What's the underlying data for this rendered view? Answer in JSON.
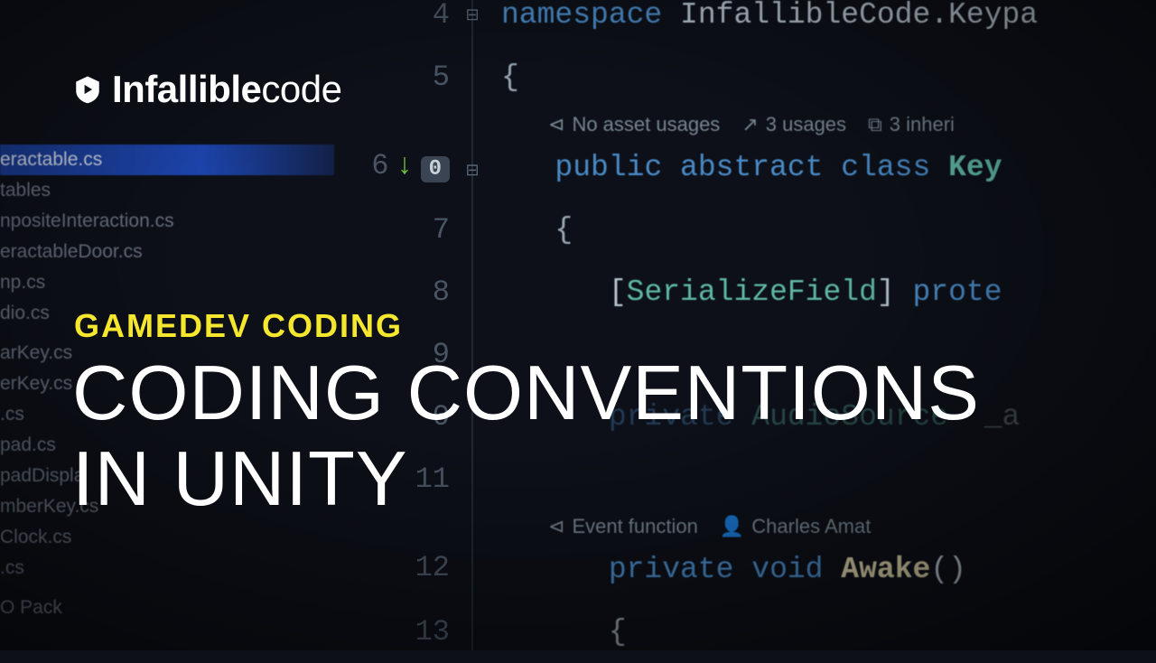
{
  "brand": {
    "bold": "Infallible",
    "thin": "code"
  },
  "overline": "GAMEDEV CODING",
  "title_line1": "CODING CONVENTIONS",
  "title_line2": "IN UNITY",
  "sidebar": {
    "items": [
      {
        "label": "eractable.cs",
        "selected": true
      },
      {
        "label": "tables",
        "selected": false
      },
      {
        "label": "npositeInteraction.cs",
        "selected": false
      },
      {
        "label": "eractableDoor.cs",
        "selected": false
      },
      {
        "label": "np.cs",
        "selected": false
      },
      {
        "label": "dio.cs",
        "selected": false
      },
      {
        "label": "",
        "selected": false
      },
      {
        "label": "arKey.cs",
        "selected": false
      },
      {
        "label": "erKey.cs",
        "selected": false
      },
      {
        "label": ".cs",
        "selected": false
      },
      {
        "label": "pad.cs",
        "selected": false
      },
      {
        "label": "padDispla",
        "selected": false
      },
      {
        "label": "mberKey.cs",
        "selected": false
      },
      {
        "label": "Clock.cs",
        "selected": false
      },
      {
        "label": ".cs",
        "selected": false
      },
      {
        "label": "",
        "selected": false
      },
      {
        "label": "O Pack",
        "selected": false
      }
    ]
  },
  "gutter": {
    "lines": [
      "4",
      "5",
      "6",
      "7",
      "8",
      "9",
      "0",
      "11",
      "12",
      "13"
    ],
    "usage_indicator": {
      "arrow": "↓",
      "count": "0"
    }
  },
  "hints": {
    "class": [
      {
        "icon": "unity",
        "text": "No asset usages"
      },
      {
        "icon": "external",
        "text": "3 usages"
      },
      {
        "icon": "inherit",
        "text": "3 inheri"
      }
    ],
    "method": [
      {
        "icon": "unity",
        "text": "Event function"
      },
      {
        "icon": "person",
        "text": "Charles Amat"
      }
    ]
  },
  "code": {
    "namespace_kw": "namespace",
    "namespace_name": " InfallibleCode.Keypa",
    "class_mods": "public abstract class ",
    "class_name": "Key ",
    "attr_open": "[",
    "attr_name": "SerializeField",
    "attr_close": "] ",
    "protected_kw": "prote",
    "priv_kw": "private ",
    "audio_type": "AudioSource",
    "audio_field": "  _a",
    "awake_priv": "private ",
    "awake_void": "void ",
    "awake_name": "Awake",
    "awake_paren": "()"
  }
}
